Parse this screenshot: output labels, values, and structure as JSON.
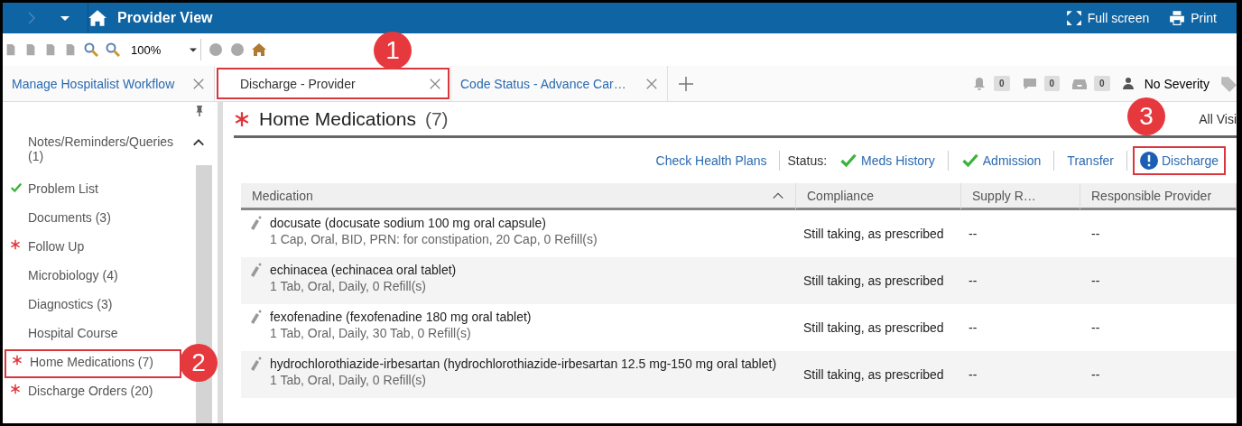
{
  "window": {
    "title": "Provider View",
    "actions": [
      {
        "kind": "fullscreen",
        "label": "Full screen"
      },
      {
        "kind": "print",
        "label": "Print"
      }
    ]
  },
  "toolbar": {
    "zoom": "100%"
  },
  "tabs": [
    {
      "label": "Manage Hospitalist Workflow",
      "selected": false
    },
    {
      "label": "Discharge - Provider",
      "selected": true,
      "callout": "1"
    },
    {
      "label": "Code Status - Advance Car…",
      "selected": false
    }
  ],
  "counters": [
    {
      "kind": "bell",
      "count": "0"
    },
    {
      "kind": "message",
      "count": "0"
    },
    {
      "kind": "inbox",
      "count": "0"
    }
  ],
  "severity": "No Severity",
  "sidebar": {
    "items": [
      {
        "label": "Notes/Reminders/Queries (1)",
        "completed": false,
        "required": false
      },
      {
        "label": "Problem List",
        "completed": true,
        "required": false
      },
      {
        "label": "Documents (3)",
        "completed": false,
        "required": false
      },
      {
        "label": "Follow Up",
        "completed": false,
        "required": true
      },
      {
        "label": "Microbiology (4)",
        "completed": false,
        "required": false
      },
      {
        "label": "Diagnostics (3)",
        "completed": false,
        "required": false
      },
      {
        "label": "Hospital Course",
        "completed": false,
        "required": false
      },
      {
        "label": "Home Medications (7)",
        "completed": false,
        "required": true,
        "callout": "2"
      },
      {
        "label": "Discharge Orders (20)",
        "completed": false,
        "required": true
      }
    ]
  },
  "section": {
    "title": "Home Medications",
    "count": "(7)",
    "required": true,
    "filter": "All Visi"
  },
  "status_bar": {
    "link": "Check Health Plans",
    "label": "Status:",
    "statuses": [
      {
        "label": "Meds History",
        "completed": true,
        "alert": false
      },
      {
        "label": "Admission",
        "completed": true,
        "alert": false
      },
      {
        "label": "Transfer",
        "completed": false,
        "alert": false
      },
      {
        "label": "Discharge",
        "completed": false,
        "alert": true,
        "callout": "3"
      }
    ]
  },
  "table": {
    "columns": [
      {
        "label": "Medication",
        "sorted": true
      },
      {
        "label": "Compliance",
        "sorted": false
      },
      {
        "label": "Supply R…",
        "sorted": false
      },
      {
        "label": "Responsible Provider",
        "sorted": false
      }
    ],
    "rows": [
      {
        "name": "docusate (docusate sodium 100 mg oral capsule)",
        "details": "1 Cap, Oral, BID, PRN: for constipation, 20 Cap, 0 Refill(s)",
        "compliance": "Still taking, as prescribed",
        "supply": "--",
        "provider": "--"
      },
      {
        "name": "echinacea (echinacea oral tablet)",
        "details": "1 Tab, Oral, Daily, 0 Refill(s)",
        "compliance": "Still taking, as prescribed",
        "supply": "--",
        "provider": "--"
      },
      {
        "name": "fexofenadine (fexofenadine 180 mg oral tablet)",
        "details": "1 Tab, Oral, Daily, 30 Tab, 0 Refill(s)",
        "compliance": "Still taking, as prescribed",
        "supply": "--",
        "provider": "--"
      },
      {
        "name": "hydrochlorothiazide-irbesartan (hydrochlorothiazide-irbesartan 12.5 mg-150 mg oral tablet)",
        "details": "1 Tab, Oral, Daily, 0 Refill(s)",
        "compliance": "Still taking, as prescribed",
        "supply": "--",
        "provider": "--"
      }
    ]
  }
}
